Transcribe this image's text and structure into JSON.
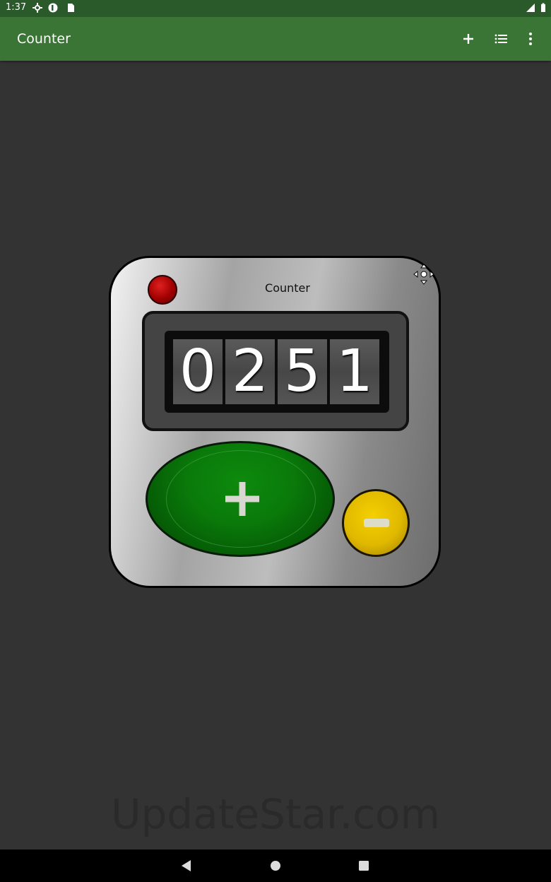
{
  "status_bar": {
    "time": "1:37",
    "icons": [
      "settings-icon",
      "app-icon",
      "sd-card-icon",
      "signal-icon",
      "battery-icon"
    ]
  },
  "app_bar": {
    "title": "Counter",
    "actions": [
      "add-icon",
      "list-icon",
      "more-vert-icon"
    ]
  },
  "counter": {
    "label": "Counter",
    "digits": [
      "0",
      "2",
      "5",
      "1"
    ],
    "increment_symbol": "+",
    "decrement_symbol": "−",
    "indicator_color": "#c00000",
    "plus_color": "#0a7a0a",
    "minus_color": "#e0b800"
  },
  "watermark": "UpdateStar.com",
  "nav_bar": {
    "buttons": [
      "back-icon",
      "home-icon",
      "recents-icon"
    ]
  }
}
